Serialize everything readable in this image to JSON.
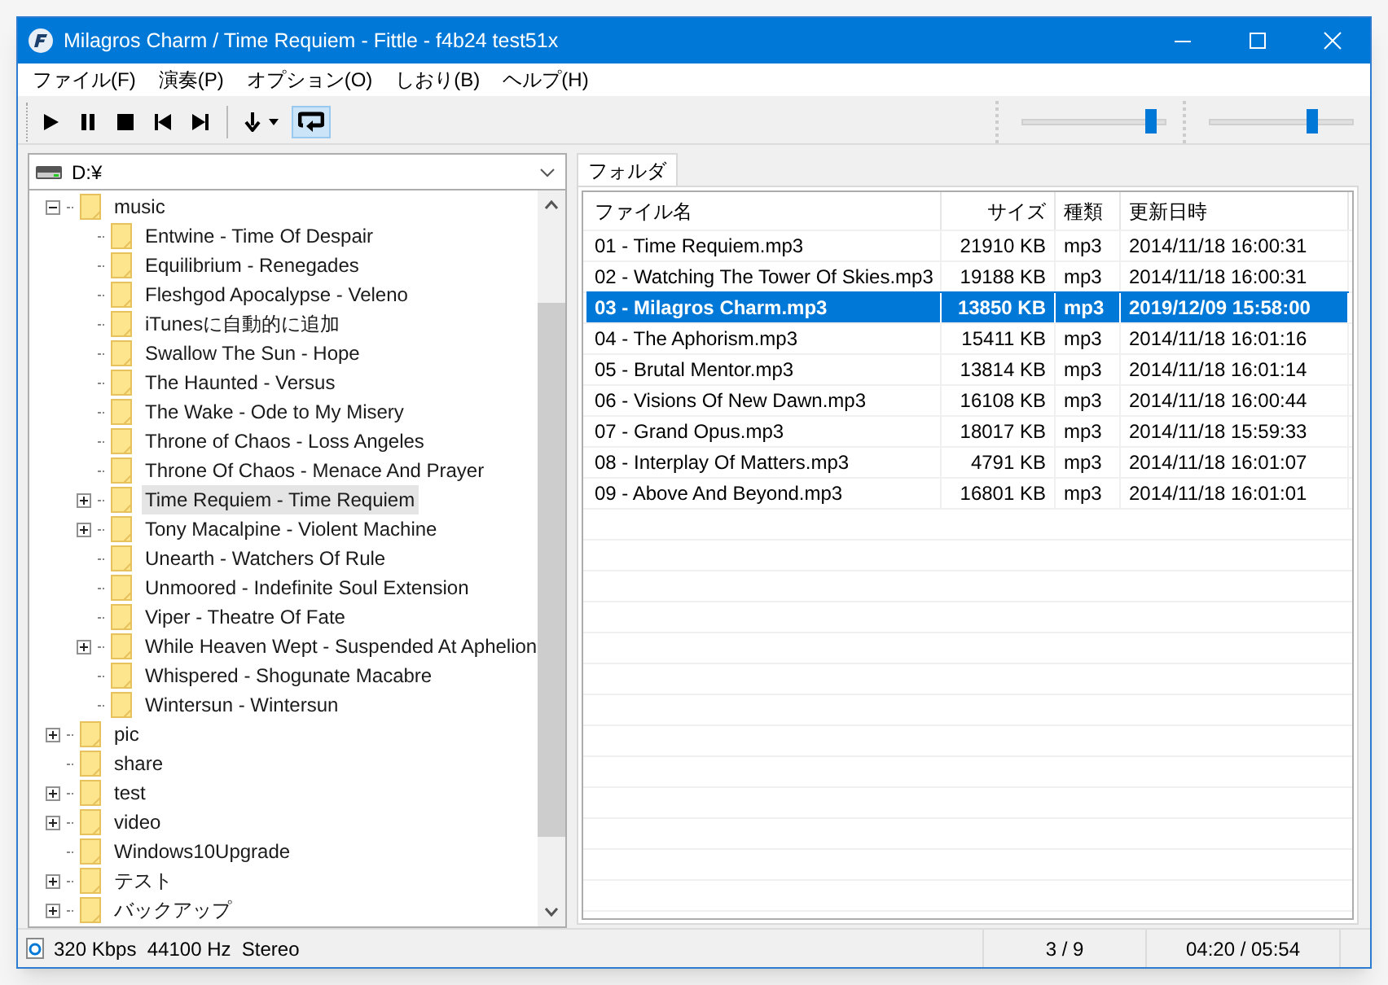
{
  "window": {
    "title": "Milagros Charm / Time Requiem - Fittle - f4b24 test51x"
  },
  "menu": [
    "ファイル(F)",
    "演奏(P)",
    "オプション(O)",
    "しおり(B)",
    "ヘルプ(H)"
  ],
  "toolbar": [
    {
      "kind": "play",
      "on": false
    },
    {
      "kind": "pause",
      "on": false
    },
    {
      "kind": "stop",
      "on": false
    },
    {
      "kind": "prev",
      "on": false
    },
    {
      "kind": "next",
      "on": false
    },
    {
      "kind": "order",
      "on": false
    },
    {
      "kind": "repeat",
      "on": true
    }
  ],
  "sliders": [
    {
      "level": 0.93
    },
    {
      "level": 0.73
    }
  ],
  "drive": {
    "value": "D:¥"
  },
  "tree": [
    {
      "label": "music",
      "expandable": true,
      "expanded": true,
      "selected": false,
      "children": [
        {
          "label": "Entwine - Time Of Despair",
          "expandable": false,
          "selected": false
        },
        {
          "label": "Equilibrium - Renegades",
          "expandable": false,
          "selected": false
        },
        {
          "label": "Fleshgod Apocalypse - Veleno",
          "expandable": false,
          "selected": false
        },
        {
          "label": "iTunesに自動的に追加",
          "expandable": false,
          "selected": false
        },
        {
          "label": "Swallow The Sun - Hope",
          "expandable": false,
          "selected": false
        },
        {
          "label": "The Haunted - Versus",
          "expandable": false,
          "selected": false
        },
        {
          "label": "The Wake - Ode to My Misery",
          "expandable": false,
          "selected": false
        },
        {
          "label": "Throne of Chaos - Loss Angeles",
          "expandable": false,
          "selected": false
        },
        {
          "label": "Throne Of Chaos - Menace And Prayer",
          "expandable": false,
          "selected": false
        },
        {
          "label": "Time Requiem - Time Requiem",
          "expandable": true,
          "expanded": false,
          "selected": true
        },
        {
          "label": "Tony Macalpine - Violent Machine",
          "expandable": true,
          "expanded": false,
          "selected": false
        },
        {
          "label": "Unearth - Watchers Of Rule",
          "expandable": false,
          "selected": false
        },
        {
          "label": "Unmoored - Indefinite Soul Extension",
          "expandable": false,
          "selected": false
        },
        {
          "label": "Viper - Theatre Of Fate",
          "expandable": false,
          "selected": false
        },
        {
          "label": "While Heaven Wept - Suspended At Aphelion",
          "expandable": true,
          "expanded": false,
          "selected": false
        },
        {
          "label": "Whispered - Shogunate Macabre",
          "expandable": false,
          "selected": false
        },
        {
          "label": "Wintersun - Wintersun",
          "expandable": false,
          "selected": false
        }
      ]
    },
    {
      "label": "pic",
      "expandable": true,
      "expanded": false,
      "selected": false
    },
    {
      "label": "share",
      "expandable": false,
      "selected": false
    },
    {
      "label": "test",
      "expandable": true,
      "expanded": false,
      "selected": false
    },
    {
      "label": "video",
      "expandable": true,
      "expanded": false,
      "selected": false
    },
    {
      "label": "Windows10Upgrade",
      "expandable": false,
      "selected": false
    },
    {
      "label": "テスト",
      "expandable": true,
      "expanded": false,
      "selected": false
    },
    {
      "label": "バックアップ",
      "expandable": true,
      "expanded": false,
      "selected": false
    }
  ],
  "tabs": [
    {
      "label": "フォルダ",
      "selected": true
    }
  ],
  "table": {
    "columns": [
      "ファイル名",
      "サイズ",
      "種類",
      "更新日時"
    ],
    "rows": [
      {
        "cells": [
          "01 - Time Requiem.mp3",
          "21910 KB",
          "mp3",
          "2014/11/18 16:00:31"
        ],
        "selected": false
      },
      {
        "cells": [
          "02 - Watching The Tower Of Skies.mp3",
          "19188 KB",
          "mp3",
          "2014/11/18 16:00:31"
        ],
        "selected": false
      },
      {
        "cells": [
          "03 - Milagros Charm.mp3",
          "13850 KB",
          "mp3",
          "2019/12/09 15:58:00"
        ],
        "selected": true
      },
      {
        "cells": [
          "04 - The Aphorism.mp3",
          "15411 KB",
          "mp3",
          "2014/11/18 16:01:16"
        ],
        "selected": false
      },
      {
        "cells": [
          "05 - Brutal Mentor.mp3",
          "13814 KB",
          "mp3",
          "2014/11/18 16:01:14"
        ],
        "selected": false
      },
      {
        "cells": [
          "06 - Visions Of New Dawn.mp3",
          "16108 KB",
          "mp3",
          "2014/11/18 16:00:44"
        ],
        "selected": false
      },
      {
        "cells": [
          "07 - Grand Opus.mp3",
          "18017 KB",
          "mp3",
          "2014/11/18 15:59:33"
        ],
        "selected": false
      },
      {
        "cells": [
          "08 - Interplay Of Matters.mp3",
          "4791 KB",
          "mp3",
          "2014/11/18 16:01:07"
        ],
        "selected": false
      },
      {
        "cells": [
          "09 - Above And Beyond.mp3",
          "16801 KB",
          "mp3",
          "2014/11/18 16:01:01"
        ],
        "selected": false
      }
    ]
  },
  "status_bar": {
    "info": "320 Kbps  44100 Hz  Stereo",
    "position": "3 / 9",
    "time": "04:20 / 05:54"
  }
}
